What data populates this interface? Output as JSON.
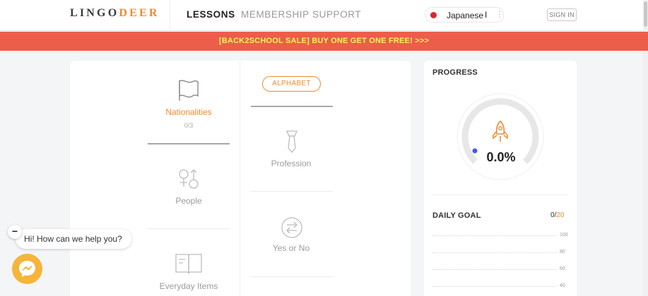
{
  "header": {
    "logo_part1": "LINGO",
    "logo_part2": "DEER",
    "nav": [
      {
        "label": "LESSONS",
        "active": true
      },
      {
        "label": "MEMBERSHIP",
        "active": false
      },
      {
        "label": "SUPPORT",
        "active": false
      }
    ],
    "language": {
      "label": "Japanese",
      "caret": "I",
      "more": "⋮"
    },
    "signin_label": "SIGN IN"
  },
  "banner": {
    "text": "[BACK2SCHOOL SALE] BUY ONE GET ONE FREE! >>>"
  },
  "lessons": {
    "pill_label": "ALPHABET",
    "col1": [
      {
        "name": "Nationalities",
        "progress": "0/3",
        "icon": "flag-icon",
        "active": true
      },
      {
        "name": "People",
        "icon": "gender-icon"
      },
      {
        "name": "Everyday Items",
        "icon": "book-icon"
      }
    ],
    "col2": [
      {
        "name": "Profession",
        "icon": "necktie-icon"
      },
      {
        "name": "Yes or No",
        "icon": "arrows-exchange-icon"
      }
    ]
  },
  "progress": {
    "title": "PROGRESS",
    "percent_label": "0.0%",
    "fraction": 0.0,
    "icon": "rocket-icon"
  },
  "daily_goal": {
    "title": "DAILY GOAL",
    "done": "0",
    "separator": "/",
    "target": "20",
    "ticks": [
      "100",
      "80",
      "60",
      "40"
    ]
  },
  "chat": {
    "prompt": "Hi! How can we help you?",
    "minimize": "−",
    "icon": "messenger-icon"
  },
  "colors": {
    "accent": "#f08a2e",
    "banner": "#ec5d4a",
    "banner_text": "#fff45a",
    "progress_dot": "#3d5bf0"
  }
}
